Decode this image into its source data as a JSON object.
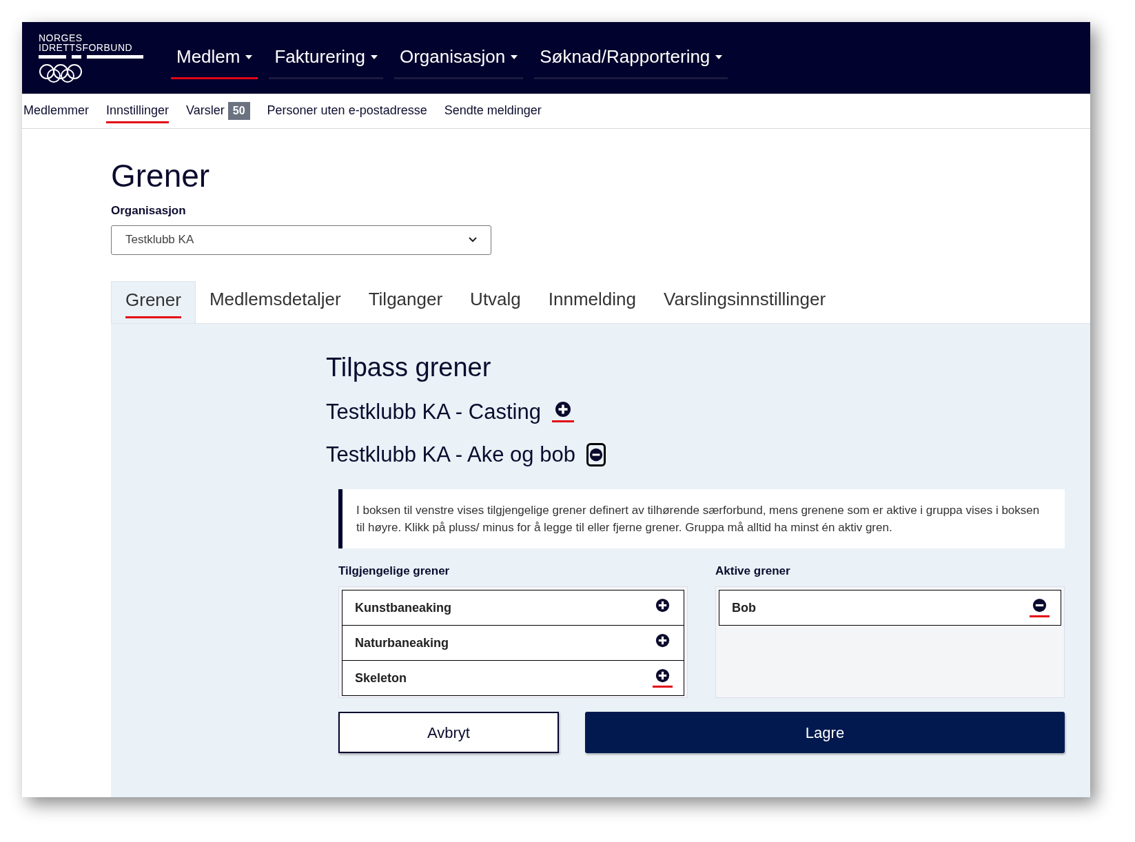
{
  "logo": {
    "lines": [
      "NORGES",
      "IDRETTSFORBUND"
    ]
  },
  "main_nav": [
    {
      "label": "Medlem",
      "selected": true
    },
    {
      "label": "Fakturering",
      "selected": false
    },
    {
      "label": "Organisasjon",
      "selected": false
    },
    {
      "label": "Søknad/Rapportering",
      "selected": false
    }
  ],
  "sub_nav": [
    {
      "label": "Medlemmer",
      "selected": false
    },
    {
      "label": "Innstillinger",
      "selected": true
    },
    {
      "label": "Varsler",
      "selected": false,
      "badge": "50"
    },
    {
      "label": "Personer uten e-postadresse",
      "selected": false
    },
    {
      "label": "Sendte meldinger",
      "selected": false
    }
  ],
  "page_title": "Grener",
  "organisation": {
    "label": "Organisasjon",
    "value": "Testklubb KA"
  },
  "tabs": [
    {
      "label": "Grener",
      "selected": true
    },
    {
      "label": "Medlemsdetaljer",
      "selected": false
    },
    {
      "label": "Tilganger",
      "selected": false
    },
    {
      "label": "Utvalg",
      "selected": false
    },
    {
      "label": "Innmelding",
      "selected": false
    },
    {
      "label": "Varslingsinnstillinger",
      "selected": false
    }
  ],
  "section_title": "Tilpass grener",
  "groups": [
    {
      "title": "Testklubb KA - Casting",
      "kind": "add",
      "underlined": true,
      "outlined": false
    },
    {
      "title": "Testklubb KA - Ake og bob",
      "kind": "remove",
      "underlined": false,
      "outlined": true
    }
  ],
  "info": "I boksen til venstre vises tilgjengelige grener definert av tilhørende særforbund, mens grenene som er aktive i gruppa vises i boksen til høyre. Klikk på pluss/ minus for å legge til eller fjerne grener. Gruppa må alltid ha minst én aktiv gren.",
  "available": {
    "label": "Tilgjengelige grener",
    "items": [
      {
        "name": "Kunstbaneaking",
        "underlined": false
      },
      {
        "name": "Naturbaneaking",
        "underlined": false
      },
      {
        "name": "Skeleton",
        "underlined": true
      }
    ]
  },
  "active": {
    "label": "Aktive grener",
    "items": [
      {
        "name": "Bob",
        "underlined": true
      }
    ]
  },
  "buttons": {
    "cancel": "Avbryt",
    "save": "Lagre"
  }
}
